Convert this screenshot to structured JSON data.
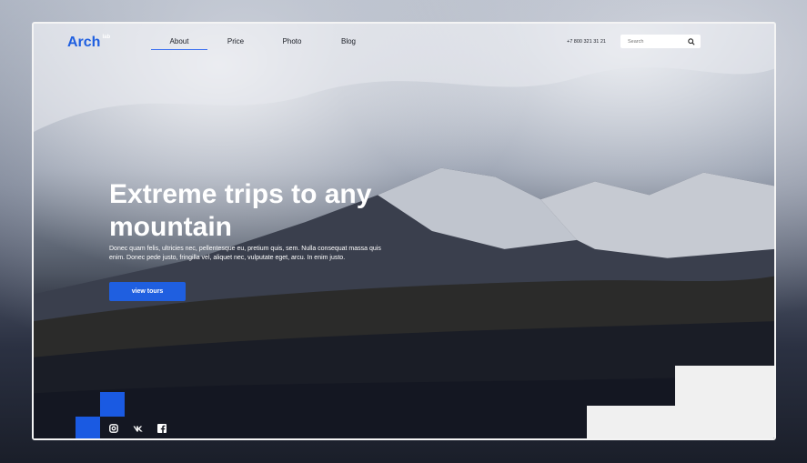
{
  "logo": {
    "text": "Arch",
    "superscript": "lab"
  },
  "nav": {
    "items": [
      {
        "label": "About"
      },
      {
        "label": "Price"
      },
      {
        "label": "Photo"
      },
      {
        "label": "Blog"
      }
    ]
  },
  "contact": {
    "phone": "+7 800 321 31 21"
  },
  "search": {
    "placeholder": "Search"
  },
  "hero": {
    "title": "Extreme trips to any mountain",
    "description": "Donec quam felis, ultricies nec, pellentesque eu, pretium quis, sem. Nulla consequat massa quis enim. Donec pede justo, fringilla vel, aliquet nec, vulputate eget, arcu. In enim justo.",
    "cta_label": "view tours"
  },
  "colors": {
    "accent": "#1f5fe0",
    "accent_block": "#1a5ae2",
    "light_block": "#f0f0f0"
  },
  "social": [
    "instagram-icon",
    "vk-icon",
    "facebook-icon"
  ]
}
